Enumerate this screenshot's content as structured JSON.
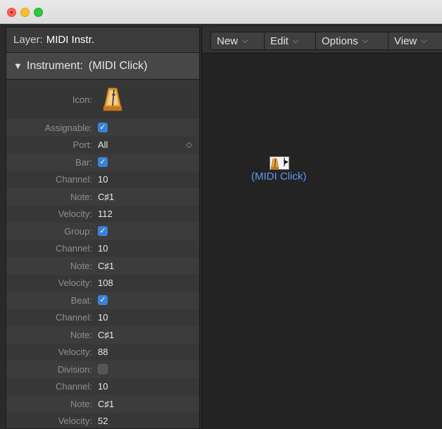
{
  "window": {
    "traffic_lights": [
      "close",
      "minimize",
      "zoom"
    ]
  },
  "inspector": {
    "layer_label": "Layer:",
    "layer_value": "MIDI Instr.",
    "instrument_label": "Instrument:",
    "instrument_name": "(MIDI Click)",
    "icon_label": "Icon:",
    "icon_name": "metronome-icon",
    "params": [
      {
        "label": "Assignable:",
        "type": "checkbox",
        "checked": true
      },
      {
        "label": "Port:",
        "type": "select",
        "value": "All"
      },
      {
        "label": "Bar:",
        "type": "checkbox",
        "checked": true
      },
      {
        "label": "Channel:",
        "type": "text",
        "value": "10"
      },
      {
        "label": "Note:",
        "type": "text",
        "value": "C♯1"
      },
      {
        "label": "Velocity:",
        "type": "text",
        "value": "112"
      },
      {
        "label": "Group:",
        "type": "checkbox",
        "checked": true
      },
      {
        "label": "Channel:",
        "type": "text",
        "value": "10"
      },
      {
        "label": "Note:",
        "type": "text",
        "value": "C♯1"
      },
      {
        "label": "Velocity:",
        "type": "text",
        "value": "108"
      },
      {
        "label": "Beat:",
        "type": "checkbox",
        "checked": true
      },
      {
        "label": "Channel:",
        "type": "text",
        "value": "10"
      },
      {
        "label": "Note:",
        "type": "text",
        "value": "C♯1"
      },
      {
        "label": "Velocity:",
        "type": "text",
        "value": "88"
      },
      {
        "label": "Division:",
        "type": "checkbox",
        "checked": false
      },
      {
        "label": "Channel:",
        "type": "text",
        "value": "10"
      },
      {
        "label": "Note:",
        "type": "text",
        "value": "C♯1"
      },
      {
        "label": "Velocity:",
        "type": "text",
        "value": "52"
      }
    ]
  },
  "menubar": {
    "new": "New",
    "edit": "Edit",
    "options": "Options",
    "view": "View",
    "chevron": "⌵"
  },
  "canvas": {
    "object_label": "(MIDI Click)",
    "object_icon": "metronome-icon"
  },
  "colors": {
    "accent": "#3b82d6",
    "object_label": "#5b9bef"
  }
}
